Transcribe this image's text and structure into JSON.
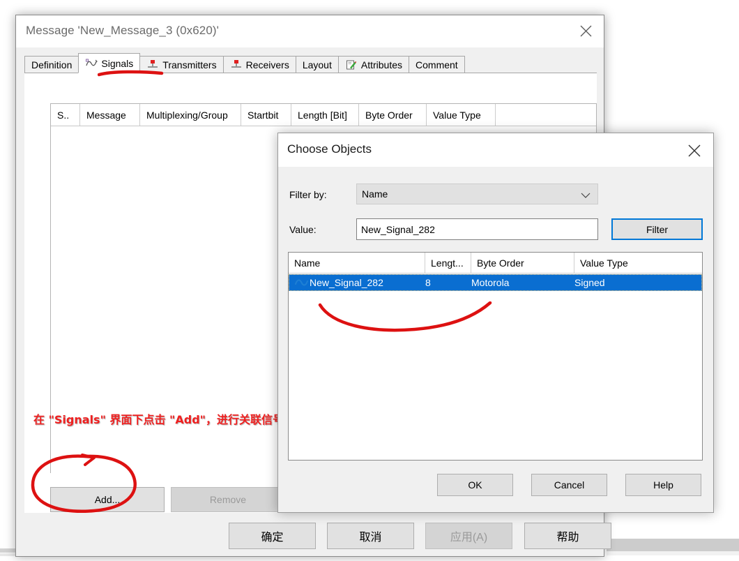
{
  "main_window": {
    "title": "Message 'New_Message_3 (0x620)'",
    "close_icon": "close-icon",
    "tabs": [
      {
        "label": "Definition",
        "icon": null,
        "active": false
      },
      {
        "label": "Signals",
        "icon": "signal-wave-icon",
        "active": true
      },
      {
        "label": "Transmitters",
        "icon": "node-transmitter-icon",
        "active": false
      },
      {
        "label": "Receivers",
        "icon": "node-receiver-icon",
        "active": false
      },
      {
        "label": "Layout",
        "icon": null,
        "active": false
      },
      {
        "label": "Attributes",
        "icon": "attributes-pencil-icon",
        "active": false
      },
      {
        "label": "Comment",
        "icon": null,
        "active": false
      }
    ],
    "grid": {
      "columns": [
        {
          "label": "S..",
          "width": 42
        },
        {
          "label": "Message",
          "width": 86
        },
        {
          "label": "Multiplexing/Group",
          "width": 145
        },
        {
          "label": "Startbit",
          "width": 72
        },
        {
          "label": "Length [Bit]",
          "width": 97
        },
        {
          "label": "Byte Order",
          "width": 97
        },
        {
          "label": "Value Type",
          "width": 99
        }
      ],
      "rows": []
    },
    "add_button": "Add...",
    "remove_button": "Remove",
    "footer_buttons": [
      {
        "label": "确定",
        "enabled": true
      },
      {
        "label": "取消",
        "enabled": true
      },
      {
        "label": "应用(A)",
        "enabled": false
      },
      {
        "label": "帮助",
        "enabled": true
      }
    ]
  },
  "annotation": {
    "text": "在 \"Signals\" 界面下点击 \"Add\"，进行关联信号的添加工作；",
    "color": "#ef2020"
  },
  "dialog": {
    "title": "Choose Objects",
    "close_icon": "close-icon",
    "filter_by_label": "Filter by:",
    "filter_by_value": "Name",
    "filter_by_options": [
      "Name"
    ],
    "value_label": "Value:",
    "value_text": "New_Signal_282",
    "value_placeholder": "",
    "filter_button": "Filter",
    "list": {
      "columns": [
        {
          "label": "Name",
          "width": 196
        },
        {
          "label": "Lengt...",
          "width": 66
        },
        {
          "label": "Byte Order",
          "width": 148
        },
        {
          "label": "Value Type",
          "width": 183
        }
      ],
      "rows": [
        {
          "icon": "signal-wave-icon",
          "name": "New_Signal_282",
          "length": "8",
          "byte_order": "Motorola",
          "value_type": "Signed",
          "selected": true
        }
      ]
    },
    "footer_buttons": [
      {
        "label": "OK"
      },
      {
        "label": "Cancel"
      },
      {
        "label": "Help"
      }
    ]
  },
  "colors": {
    "selection_blue": "#0a6ed1",
    "focus_blue": "#0078d7",
    "annotation_red": "#ef2020",
    "window_bg": "#f0f0f0"
  }
}
